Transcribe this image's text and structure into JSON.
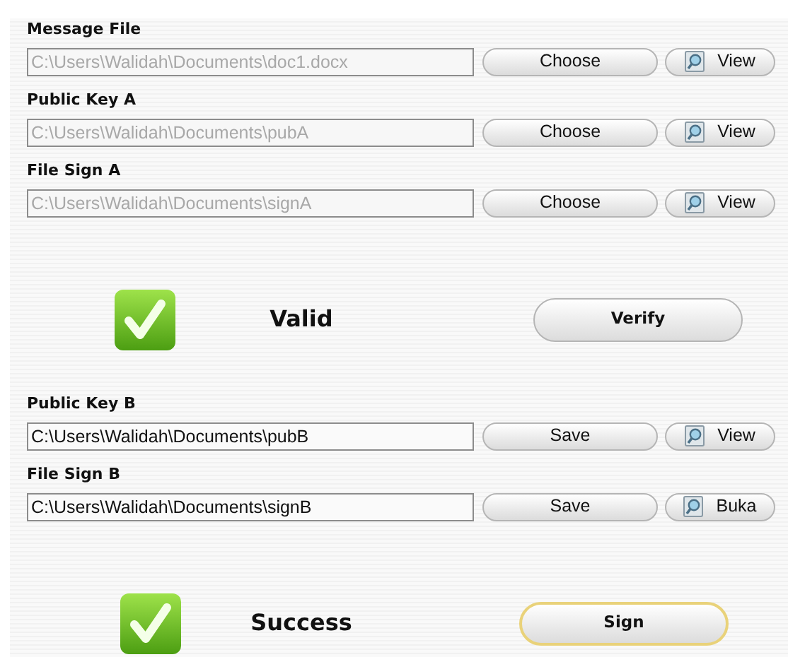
{
  "sections": [
    {
      "kind": "file",
      "label": "Message File",
      "value": "C:\\Users\\Walidah\\Documents\\doc1.docx",
      "disabled": true,
      "action": "Choose",
      "view": "View"
    },
    {
      "kind": "file",
      "label": "Public Key A",
      "value": "C:\\Users\\Walidah\\Documents\\pubA",
      "disabled": true,
      "action": "Choose",
      "view": "View"
    },
    {
      "kind": "file",
      "label": "File Sign A",
      "value": "C:\\Users\\Walidah\\Documents\\signA",
      "disabled": true,
      "action": "Choose",
      "view": "View"
    },
    {
      "kind": "status",
      "ok": true,
      "message": "Valid",
      "button": "Verify",
      "focused": false
    },
    {
      "kind": "file",
      "label": "Public Key B",
      "value": "C:\\Users\\Walidah\\Documents\\pubB",
      "disabled": false,
      "action": "Save",
      "view": "View"
    },
    {
      "kind": "file",
      "label": "File Sign B",
      "value": "C:\\Users\\Walidah\\Documents\\signB",
      "disabled": false,
      "action": "Save",
      "view": "Buka"
    },
    {
      "kind": "status",
      "ok": true,
      "message": "Success",
      "button": "Sign",
      "focused": true
    }
  ]
}
